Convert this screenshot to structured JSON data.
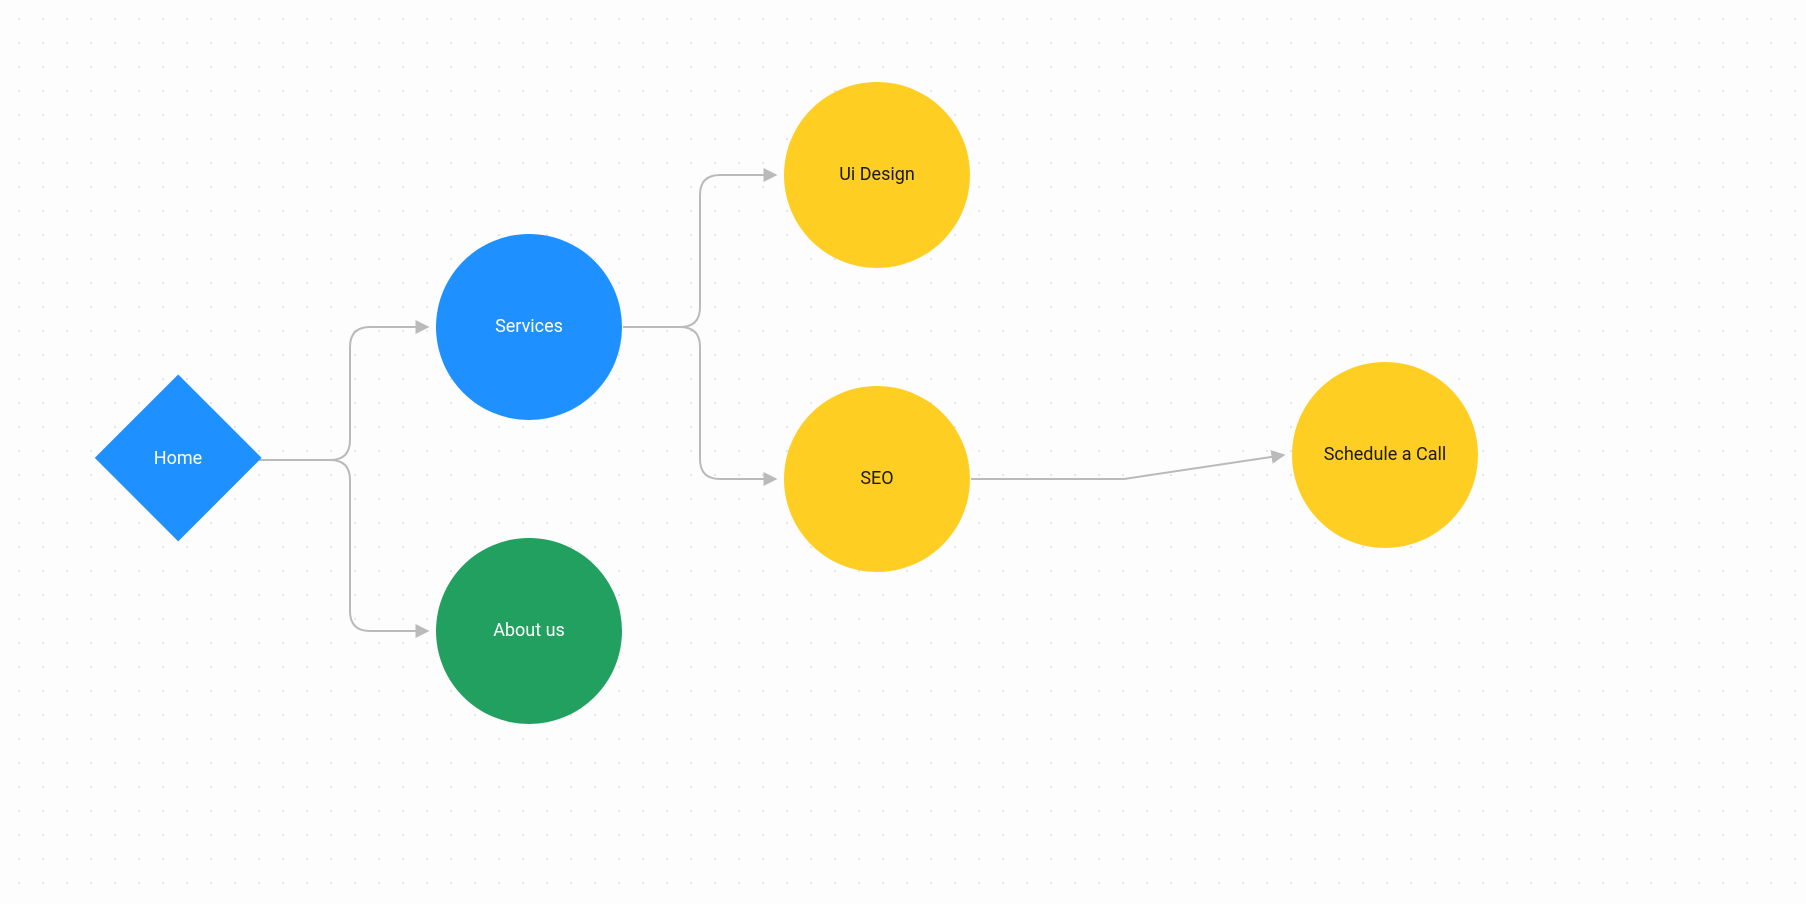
{
  "nodes": {
    "home": {
      "label": "Home",
      "shape": "diamond",
      "color": "#1E90FF",
      "text": "#ffffff"
    },
    "services": {
      "label": "Services",
      "shape": "circle",
      "color": "#1E90FF",
      "text": "#ffffff"
    },
    "about": {
      "label": "About us",
      "shape": "circle",
      "color": "#21A05F",
      "text": "#ffffff"
    },
    "uidesign": {
      "label": "Ui Design",
      "shape": "circle",
      "color": "#FFCE22",
      "text": "#1a1a1a"
    },
    "seo": {
      "label": "SEO",
      "shape": "circle",
      "color": "#FFCE22",
      "text": "#1a1a1a"
    },
    "schedule": {
      "label": "Schedule a Call",
      "shape": "circle",
      "color": "#FFCE22",
      "text": "#1a1a1a"
    }
  },
  "edges": [
    {
      "from": "home",
      "to": "services"
    },
    {
      "from": "home",
      "to": "about"
    },
    {
      "from": "services",
      "to": "uidesign"
    },
    {
      "from": "services",
      "to": "seo"
    },
    {
      "from": "seo",
      "to": "schedule"
    }
  ],
  "canvas": {
    "background": "#fdfdfd",
    "dot_color": "#dcdcdc",
    "connector_color": "#bababa"
  }
}
